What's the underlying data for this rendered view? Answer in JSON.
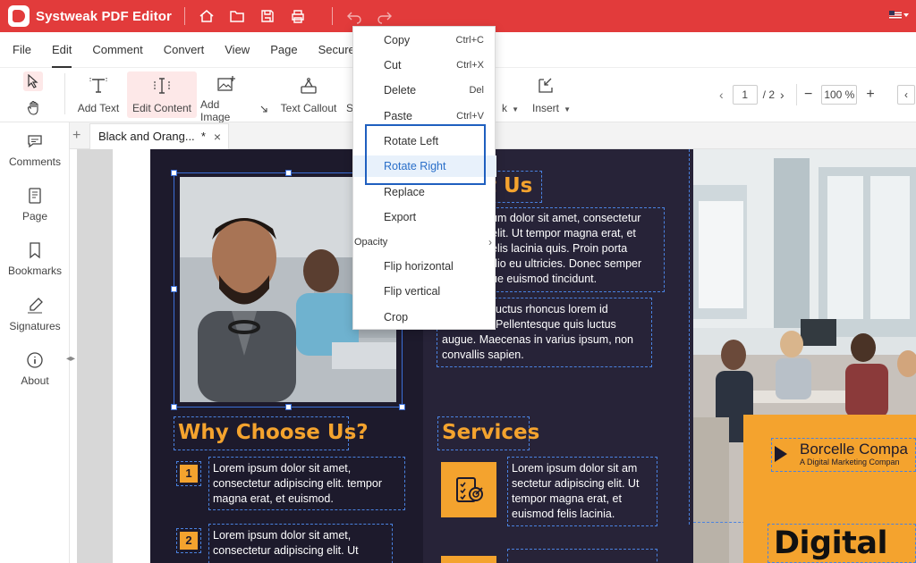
{
  "app": {
    "title": "Systweak PDF Editor"
  },
  "menubar": [
    "File",
    "Edit",
    "Comment",
    "Convert",
    "View",
    "Page",
    "Secure",
    "F"
  ],
  "toolbar": {
    "tools": [
      "Add Text",
      "Edit Content",
      "Add Image",
      "Text Callout",
      "S",
      "k",
      "Insert"
    ],
    "page_current": "1",
    "page_total": "/ 2",
    "zoom": "100 %"
  },
  "sidebar": [
    "Comments",
    "Page",
    "Bookmarks",
    "Signatures",
    "About"
  ],
  "tab": {
    "title": "Black and Orang...  *",
    "close": "×",
    "new": "+"
  },
  "context_menu": {
    "items": [
      {
        "label": "Copy",
        "shortcut": "Ctrl+C"
      },
      {
        "label": "Cut",
        "shortcut": "Ctrl+X"
      },
      {
        "label": "Delete",
        "shortcut": "Del"
      },
      {
        "label": "Paste",
        "shortcut": "Ctrl+V"
      },
      {
        "label": "Rotate Left",
        "shortcut": ""
      },
      {
        "label": "Rotate Right",
        "shortcut": ""
      },
      {
        "label": "Replace",
        "shortcut": ""
      },
      {
        "label": "Export",
        "shortcut": ""
      },
      {
        "label": "Opacity",
        "shortcut": ""
      },
      {
        "label": "Flip horizontal",
        "shortcut": ""
      },
      {
        "label": "Flip vertical",
        "shortcut": ""
      },
      {
        "label": "Crop",
        "shortcut": ""
      }
    ],
    "submenu_arrow": "›"
  },
  "document": {
    "about_heading": "t Us",
    "about_text": [
      "um dolor sit amet, consectetur",
      "elit. Ut tempor magna erat, et",
      "elis lacinia quis. Proin porta",
      "dio eu ultricies. Donec semper",
      "ue euismod tincidunt."
    ],
    "about_text2": [
      "uctus rhoncus lorem id",
      "Pellentesque quis luctus",
      "augue. Maecenas in varius ipsum, non",
      "convallis sapien."
    ],
    "about_text2_prefix": "f",
    "why_heading": "Why Choose Us?",
    "why_items": [
      {
        "num": "1",
        "text": [
          "Lorem ipsum dolor sit amet,",
          "consectetur adipiscing elit. tempor",
          "magna erat, et euismod."
        ]
      },
      {
        "num": "2",
        "text": [
          "Lorem ipsum dolor sit amet,",
          "consectetur adipiscing elit. Ut"
        ]
      }
    ],
    "services_heading": "Services",
    "services_text": [
      "Lorem ipsum dolor sit am",
      "sectetur adipiscing elit. Ut",
      "tempor magna erat, et",
      "euismod felis lacinia."
    ],
    "brand_name": "Borcelle Compa",
    "brand_sub": "A Digital Marketing Compan",
    "big_title": "Digital"
  },
  "colors": {
    "brand_red": "#e23b3b",
    "accent_orange": "#f4a32e",
    "dark_bg": "#1d1a2c",
    "selection_blue": "#3b6fd8",
    "menu_hover": "#e8f1fb"
  }
}
